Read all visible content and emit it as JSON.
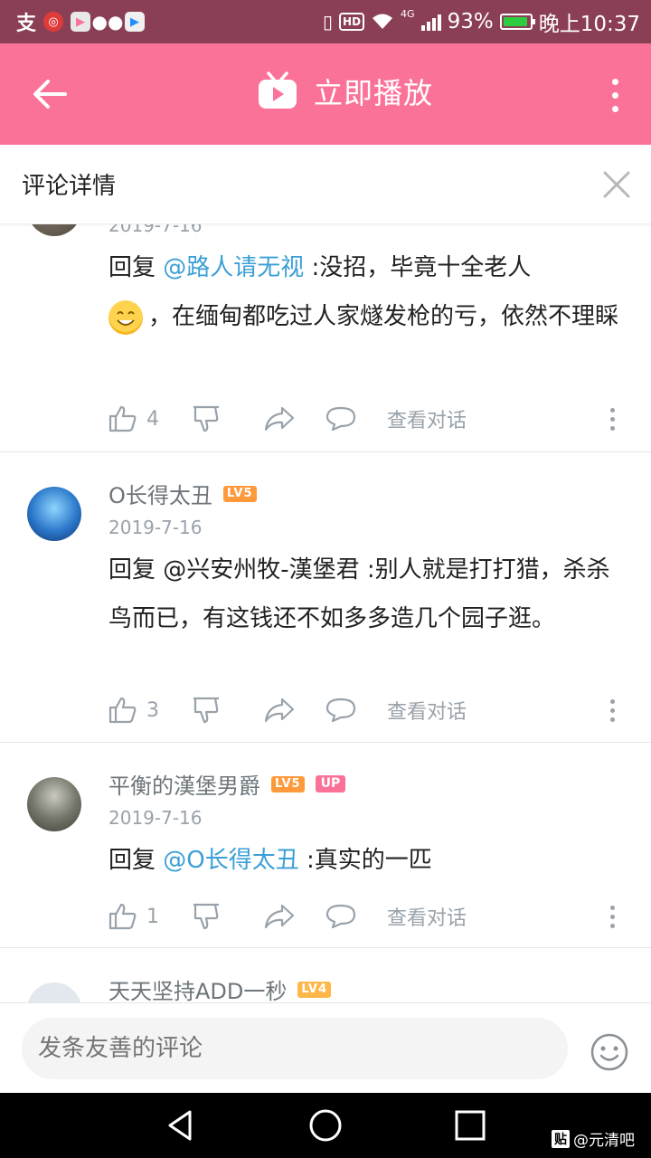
{
  "status_bar": {
    "battery": "93%",
    "time": "晚上10:37",
    "network": "4G"
  },
  "app_bar": {
    "play_label": "立即播放"
  },
  "detail": {
    "title": "评论详情"
  },
  "comments": [
    {
      "date": "2019-7-16",
      "reply_prefix": "回复 ",
      "mention": "@路人请无视",
      "text_line1": " :没招，毕竟十全老人",
      "text_rest": "，在缅甸都吃过人家燧发枪的亏，依然不理睬",
      "likes": "4",
      "view_conversation": "查看对话"
    },
    {
      "username": "O长得太丑",
      "level": "LV5",
      "date": "2019-7-16",
      "text": "回复 @兴安州牧-漢堡君 :别人就是打打猎，杀杀鸟而已，有这钱还不如多多造几个园子逛。",
      "likes": "3",
      "view_conversation": "查看对话"
    },
    {
      "username": "平衡的漢堡男爵",
      "level": "LV5",
      "badge": "UP",
      "date": "2019-7-16",
      "reply_prefix": "回复 ",
      "mention": "@O长得太丑",
      "text": " :真实的一匹",
      "likes": "1",
      "view_conversation": "查看对话"
    },
    {
      "username": "天天坚持ADD一秒",
      "level": "LV4"
    }
  ],
  "composer": {
    "placeholder": "发条友善的评论"
  },
  "watermark": {
    "badge": "贴",
    "text": "@元清吧"
  },
  "colors": {
    "brand_pink": "#fb7299",
    "status_bar": "#8b3f55",
    "mention_blue": "#3b9fd5",
    "secondary_text": "#99a2aa"
  }
}
